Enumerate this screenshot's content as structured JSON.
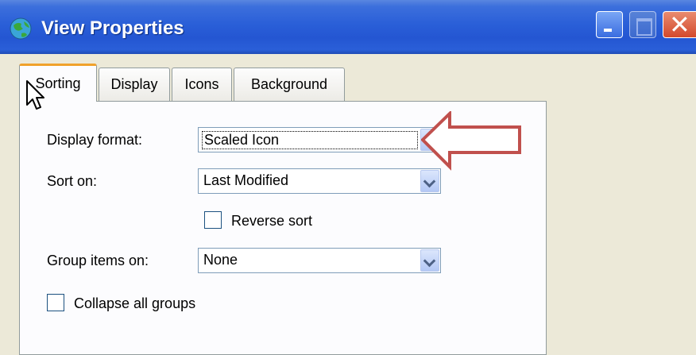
{
  "window": {
    "title": "View Properties",
    "icon": "globe-icon",
    "controls": [
      "minimize-icon",
      "maximize-icon",
      "close-icon"
    ]
  },
  "tabs": [
    {
      "label": "Sorting",
      "active": true
    },
    {
      "label": "Display",
      "active": false
    },
    {
      "label": "Icons",
      "active": false
    },
    {
      "label": "Background",
      "active": false
    }
  ],
  "sorting": {
    "display_format_label": "Display format:",
    "display_format_value": "Scaled Icon",
    "sort_on_label": "Sort on:",
    "sort_on_value": "Last Modified",
    "reverse_sort_label": "Reverse sort",
    "reverse_sort_checked": false,
    "group_items_label": "Group items on:",
    "group_items_value": "None",
    "collapse_groups_label": "Collapse all groups",
    "collapse_groups_checked": false
  },
  "annotation": {
    "type": "arrow-left",
    "color": "#c0504d"
  },
  "colors": {
    "titlebar": "#2a5fd8",
    "tab_accent": "#f0a12b",
    "panel_bg": "#fcfcfe",
    "window_bg": "#ece9d8"
  }
}
